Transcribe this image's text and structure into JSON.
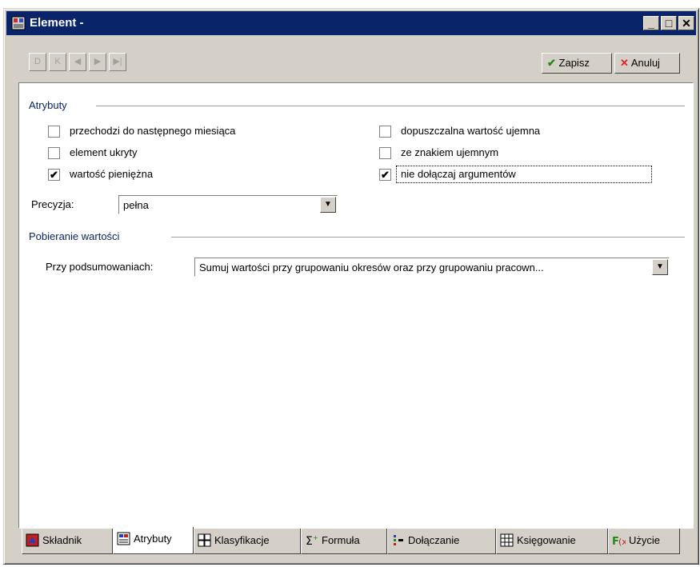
{
  "window": {
    "title": "Element -"
  },
  "caption_buttons": {
    "minimize": "_",
    "maximize": "□",
    "close": "✕"
  },
  "toolbar": {
    "nav_first": "D",
    "nav_prev_page": "K",
    "nav_prev": "◀",
    "nav_next": "▶",
    "nav_last": "▶|",
    "save_label": "Zapisz",
    "cancel_label": "Anuluj",
    "save_icon": "✔",
    "cancel_icon": "✕",
    "save_color": "#1a8a1a",
    "cancel_color": "#e02020"
  },
  "attributes": {
    "group_label": "Atrybuty",
    "checkboxes": [
      {
        "label": "przechodzi do następnego miesiąca",
        "checked": false
      },
      {
        "label": "element ukryty",
        "checked": false
      },
      {
        "label": "wartość pieniężna",
        "checked": true
      },
      {
        "label": "dopuszczalna wartość ujemna",
        "checked": false
      },
      {
        "label": "ze znakiem ujemnym",
        "checked": false
      },
      {
        "label": "nie dołączaj argumentów",
        "checked": true
      }
    ],
    "precision_label": "Precyzja:",
    "precision_value": "pełna"
  },
  "fetching": {
    "group_label": "Pobieranie wartości",
    "summaries_label": "Przy podsumowaniach:",
    "summaries_value": "Sumuj wartości przy grupowaniu okresów oraz przy grupowaniu pracown..."
  },
  "tabs": [
    {
      "label": "Składnik",
      "icon": "skladnik-icon",
      "active": false
    },
    {
      "label": "Atrybuty",
      "icon": "atrybuty-icon",
      "active": true
    },
    {
      "label": "Klasyfikacje",
      "icon": "klasyfikacje-icon",
      "active": false
    },
    {
      "label": "Formuła",
      "icon": "formula-icon",
      "active": false
    },
    {
      "label": "Dołączanie",
      "icon": "dolaczanie-icon",
      "active": false
    },
    {
      "label": "Księgowanie",
      "icon": "ksiegowanie-icon",
      "active": false
    },
    {
      "label": "Użycie",
      "icon": "uzycie-icon",
      "active": false
    }
  ],
  "checkmark": "✔"
}
